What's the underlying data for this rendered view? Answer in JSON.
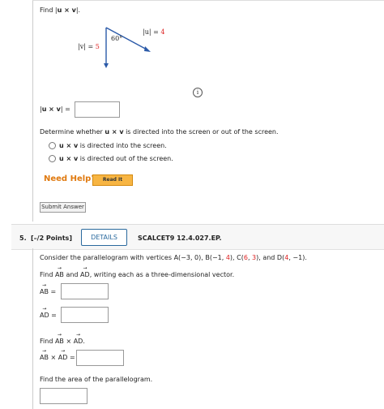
{
  "q4": {
    "prompt_prefix": "Find |",
    "prompt_uv": "u × v",
    "prompt_suffix": "|.",
    "diagram": {
      "angle": "60°",
      "u_label_prefix": "|u| = ",
      "u_value": "4",
      "v_label_prefix": "|v| = ",
      "v_value": "5"
    },
    "answer_label_prefix": "|",
    "answer_label_uv": "u × v",
    "answer_label_suffix": "| =",
    "direction_prompt_a": "Determine whether ",
    "direction_prompt_b": "u × v",
    "direction_prompt_c": " is directed into the screen or out of the screen.",
    "option_into_bold": "u × v",
    "option_into_text": " is directed into the screen.",
    "option_out_bold": "u × v",
    "option_out_text": " is directed out of the screen.",
    "need_help": "Need Help?",
    "read_it": "Read It",
    "submit": "Submit Answer"
  },
  "q5": {
    "number": "5.",
    "points": "[–/2 Points]",
    "details": "DETAILS",
    "code": "SCALCET9 12.4.027.EP.",
    "intro_a": "Consider the parallelogram with vertices ",
    "A": "A(−3, 0)",
    "B_pre": ", B(−1, ",
    "B_red": "4",
    "B_post": "), C(",
    "C_red1": "6",
    "C_mid": ", ",
    "C_red2": "3",
    "C_post": "), and D(",
    "D_red": "4",
    "D_post": ", −1).",
    "find_vec_a": "Find ",
    "ab": "AB",
    "and": " and ",
    "ad": "AD",
    "find_vec_b": ", writing each as a three-dimensional vector.",
    "eq": " =",
    "find_cross_a": "Find ",
    "times": " × ",
    "find_cross_b": ".",
    "find_area": "Find the area of the parallelogram."
  }
}
